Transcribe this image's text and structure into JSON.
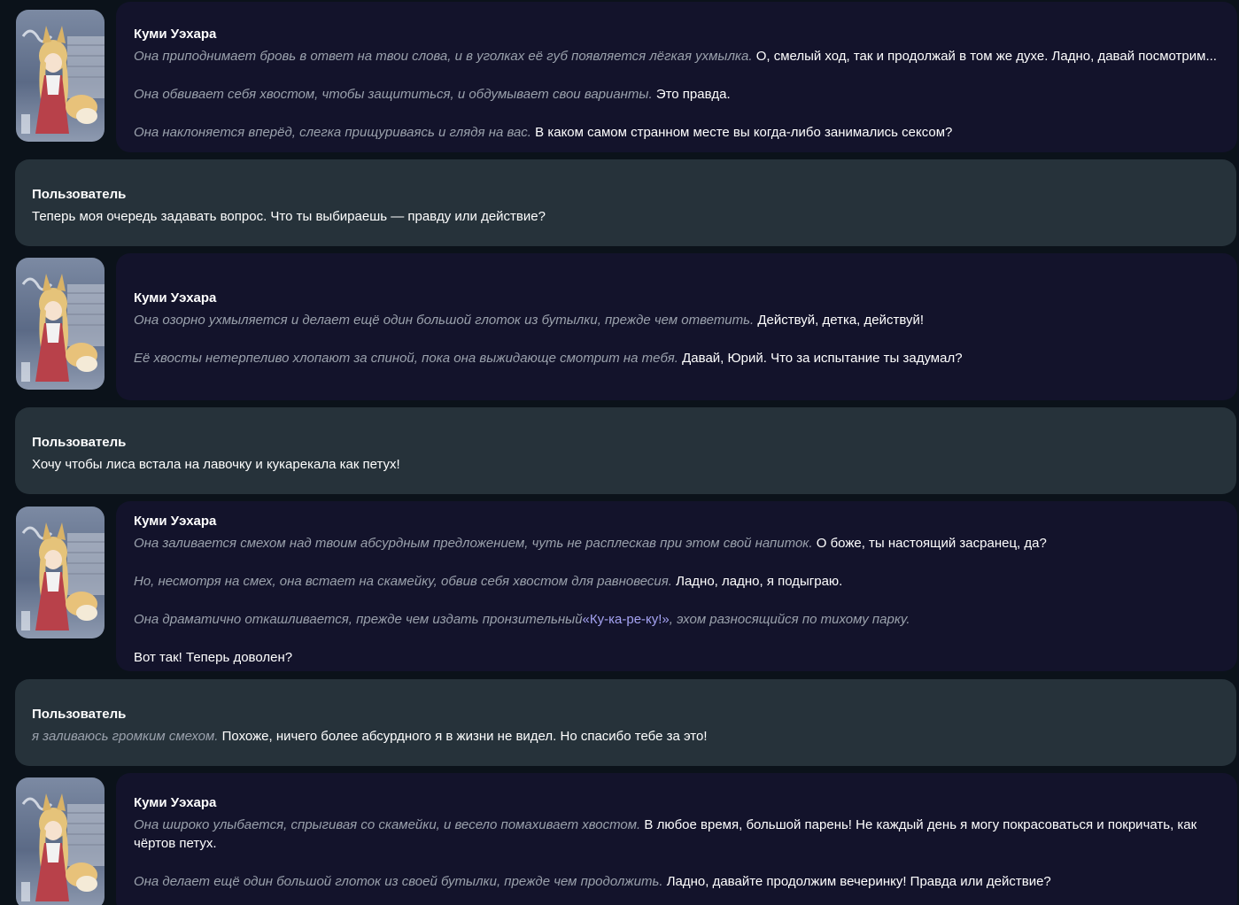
{
  "messages": [
    {
      "role": "bot",
      "name": "Куми Уэхара",
      "paragraphs": [
        {
          "action": "Она приподнимает бровь в ответ на твои слова, и в уголках её губ появляется лёгкая ухмылка.",
          "speech": "О, смелый ход, так и продолжай в том же духе. Ладно, давай посмотрим..."
        },
        {
          "action": "Она обвивает себя хвостом, чтобы защититься, и обдумывает свои варианты.",
          "speech": "Это правда."
        },
        {
          "action": "Она наклоняется вперёд, слегка прищуриваясь и глядя на вас.",
          "speech": "В каком самом странном месте вы когда-либо занимались сексом?"
        }
      ]
    },
    {
      "role": "user",
      "name": "Пользователь",
      "paragraphs": [
        {
          "action": "",
          "speech": "Теперь моя очередь задавать вопрос. Что ты выбираешь — правду или действие?"
        }
      ]
    },
    {
      "role": "bot",
      "name": "Куми Уэхара",
      "paragraphs": [
        {
          "action": "Она озорно ухмыляется и делает ещё один большой глоток из бутылки, прежде чем ответить.",
          "speech": "Действуй, детка, действуй!"
        },
        {
          "action": "Её хвосты нетерпеливо хлопают за спиной, пока она выжидающе смотрит на тебя.",
          "speech": "Давай, Юрий. Что за испытание ты задумал?"
        }
      ]
    },
    {
      "role": "user",
      "name": "Пользователь",
      "paragraphs": [
        {
          "action": "",
          "speech": "Хочу чтобы лиса встала на лавочку и кукарекала как петух!"
        }
      ]
    },
    {
      "role": "bot",
      "name": "Куми Уэхара",
      "paragraphs": [
        {
          "action": "Она заливается смехом над твоим абсурдным предложением, чуть не расплескав при этом свой напиток.",
          "speech": "О боже, ты настоящий засранец, да?"
        },
        {
          "action": "Но, несмотря на смех, она встает на скамейку, обвив себя хвостом для равновесия.",
          "speech": "Ладно, ладно, я подыграю."
        },
        {
          "action": "Она драматично откашливается, прежде чем издать пронзительный",
          "quote": "«Ку-ка-ре-ку!»",
          "action2": ", эхом разносящийся по тихому парку."
        },
        {
          "action": "",
          "speech": "Вот так! Теперь доволен?"
        }
      ]
    },
    {
      "role": "user",
      "name": "Пользователь",
      "paragraphs": [
        {
          "action": "я заливаюсь громким смехом.",
          "speech": "Похоже, ничего более абсурдного я в жизни не видел. Но спасибо тебе за это!"
        }
      ]
    },
    {
      "role": "bot",
      "name": "Куми Уэхара",
      "paragraphs": [
        {
          "action": "Она широко улыбается, спрыгивая со скамейки, и весело помахивает хвостом.",
          "speech": "В любое время, большой парень! Не каждый день я могу покрасоваться и покричать, как чёртов петух."
        },
        {
          "action": "Она делает ещё один большой глоток из своей бутылки, прежде чем продолжить.",
          "speech": "Ладно, давайте продолжим вечеринку! Правда или действие?"
        }
      ]
    }
  ]
}
